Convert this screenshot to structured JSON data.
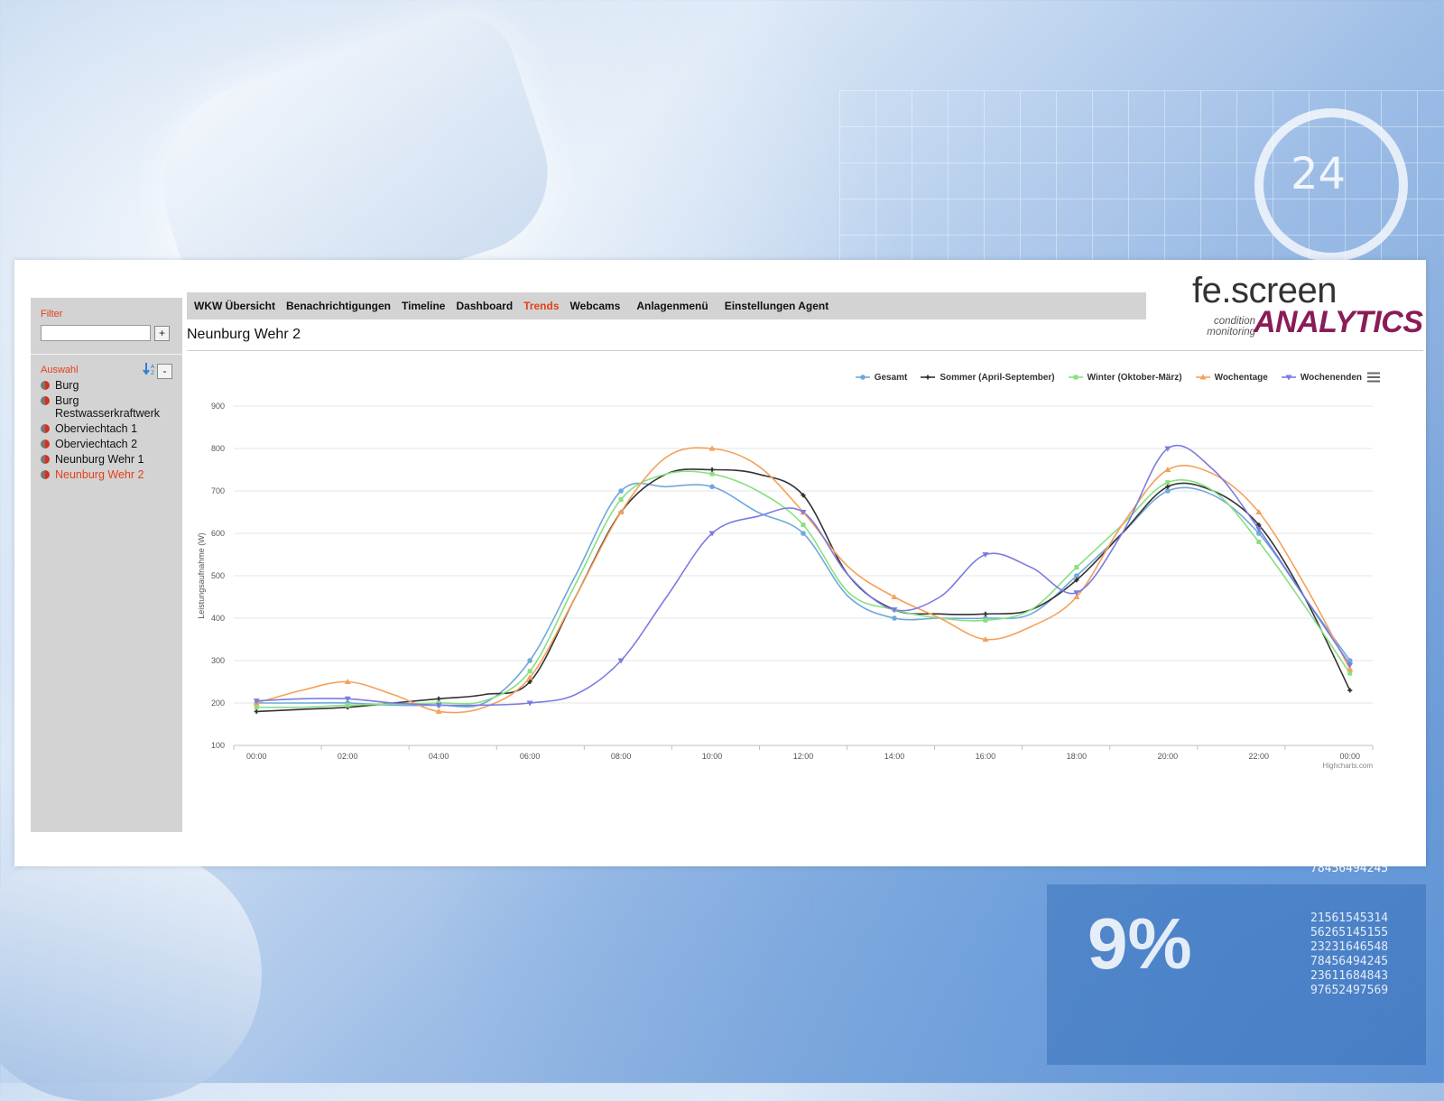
{
  "background": {
    "ring_text": "24",
    "percent_text": "9%",
    "number_top": "78456494245",
    "numbers": [
      "21561545314",
      "56265145155",
      "23231646548",
      "78456494245",
      "23611684843",
      "97652497569"
    ]
  },
  "sidebar": {
    "filter_label": "Filter",
    "filter_value": "",
    "add_button": "+",
    "selection_label": "Auswahl",
    "collapse_button": "-",
    "items": [
      {
        "label": "Burg",
        "active": false
      },
      {
        "label": "Burg Restwasserkraftwerk",
        "active": false
      },
      {
        "label": "Oberviechtach 1",
        "active": false
      },
      {
        "label": "Oberviechtach 2",
        "active": false
      },
      {
        "label": "Neunburg Wehr 1",
        "active": false
      },
      {
        "label": "Neunburg Wehr 2",
        "active": true
      }
    ]
  },
  "nav": {
    "items": [
      {
        "label": "WKW Übersicht",
        "active": false
      },
      {
        "label": "Benachrichtigungen",
        "active": false
      },
      {
        "label": "Timeline",
        "active": false
      },
      {
        "label": "Dashboard",
        "active": false
      },
      {
        "label": "Trends",
        "active": true
      },
      {
        "label": "Webcams",
        "active": false
      },
      {
        "label": "Anlagenmenü",
        "active": false
      },
      {
        "label": "Einstellungen Agent",
        "active": false
      }
    ]
  },
  "logo": {
    "brand": "fe.screen",
    "tagline": "condition monitoring",
    "product": "ANALYTICS"
  },
  "page": {
    "title": "Neunburg Wehr 2"
  },
  "colors": {
    "accent": "#e3401b",
    "nav_bg": "#d3d3d3",
    "brand_purple": "#8a1c57"
  },
  "chart_data": {
    "type": "line",
    "ylabel": "Leistungsaufnahme (W)",
    "ylim": [
      100,
      900
    ],
    "yticks": [
      100,
      200,
      300,
      400,
      500,
      600,
      700,
      800,
      900
    ],
    "x": [
      "00:00",
      "01:00",
      "02:00",
      "03:00",
      "04:00",
      "05:00",
      "06:00",
      "07:00",
      "08:00",
      "09:00",
      "10:00",
      "11:00",
      "12:00",
      "13:00",
      "14:00",
      "15:00",
      "16:00",
      "17:00",
      "18:00",
      "19:00",
      "20:00",
      "21:00",
      "22:00",
      "23:00",
      "00:00"
    ],
    "xtick_labels": [
      "00:00",
      "02:00",
      "04:00",
      "06:00",
      "08:00",
      "10:00",
      "12:00",
      "14:00",
      "16:00",
      "18:00",
      "20:00",
      "22:00",
      "00:00"
    ],
    "grid": true,
    "legend_position": "top-right",
    "credits": "Highcharts.com",
    "series": [
      {
        "name": "Gesamt",
        "color": "#6ea8dc",
        "marker": "circle",
        "values": [
          200,
          200,
          200,
          195,
          195,
          200,
          300,
          500,
          700,
          710,
          710,
          650,
          600,
          450,
          400,
          400,
          400,
          410,
          500,
          600,
          700,
          690,
          600,
          450,
          300
        ]
      },
      {
        "name": "Sommer (April-September)",
        "color": "#333333",
        "marker": "cross",
        "values": [
          180,
          185,
          190,
          200,
          210,
          220,
          250,
          450,
          650,
          740,
          750,
          740,
          690,
          500,
          420,
          410,
          410,
          420,
          490,
          600,
          710,
          700,
          620,
          450,
          230
        ]
      },
      {
        "name": "Winter (Oktober-März)",
        "color": "#88e080",
        "marker": "square",
        "values": [
          190,
          190,
          195,
          198,
          200,
          205,
          275,
          480,
          680,
          740,
          740,
          700,
          620,
          460,
          420,
          400,
          395,
          420,
          520,
          620,
          720,
          700,
          580,
          430,
          270
        ]
      },
      {
        "name": "Wochentage",
        "color": "#f5a05a",
        "marker": "triangle",
        "values": [
          200,
          230,
          250,
          220,
          180,
          190,
          260,
          450,
          650,
          780,
          800,
          760,
          650,
          520,
          450,
          400,
          350,
          380,
          450,
          620,
          750,
          740,
          650,
          480,
          280
        ]
      },
      {
        "name": "Wochenenden",
        "color": "#7b7be0",
        "marker": "triangle-down",
        "values": [
          205,
          210,
          210,
          200,
          195,
          195,
          200,
          220,
          300,
          450,
          600,
          640,
          650,
          500,
          420,
          450,
          550,
          520,
          460,
          600,
          800,
          750,
          610,
          450,
          290
        ]
      }
    ]
  }
}
